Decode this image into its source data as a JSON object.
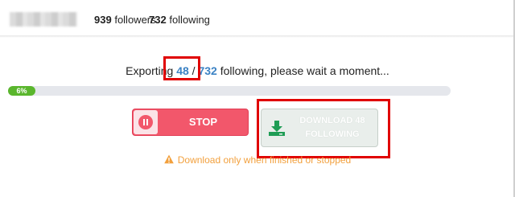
{
  "profile": {
    "followers_count": "939",
    "followers_label": "followers",
    "following_count": "732",
    "following_label": "following"
  },
  "export": {
    "prefix": "Exporting ",
    "current": "48",
    "separator": " / ",
    "total": "732",
    "suffix": " following, please wait a moment..."
  },
  "progress": {
    "percent_value": 0.06,
    "percent_label": "6%"
  },
  "buttons": {
    "stop_label": "STOP",
    "download_label": "DOWNLOAD 48 FOLLOWING"
  },
  "warning": {
    "text": "Download only when finished or stopped",
    "icon": "warning-triangle-icon"
  },
  "colors": {
    "accent_blue": "#3b82c4",
    "progress_green": "#5ab62d",
    "stop_red": "#f2576b",
    "download_green": "#1f9d55",
    "warning_orange": "#f2a03d",
    "highlight_red": "#e00000"
  },
  "icons": {
    "stop": "pause-circle-icon",
    "download": "download-tray-icon"
  }
}
